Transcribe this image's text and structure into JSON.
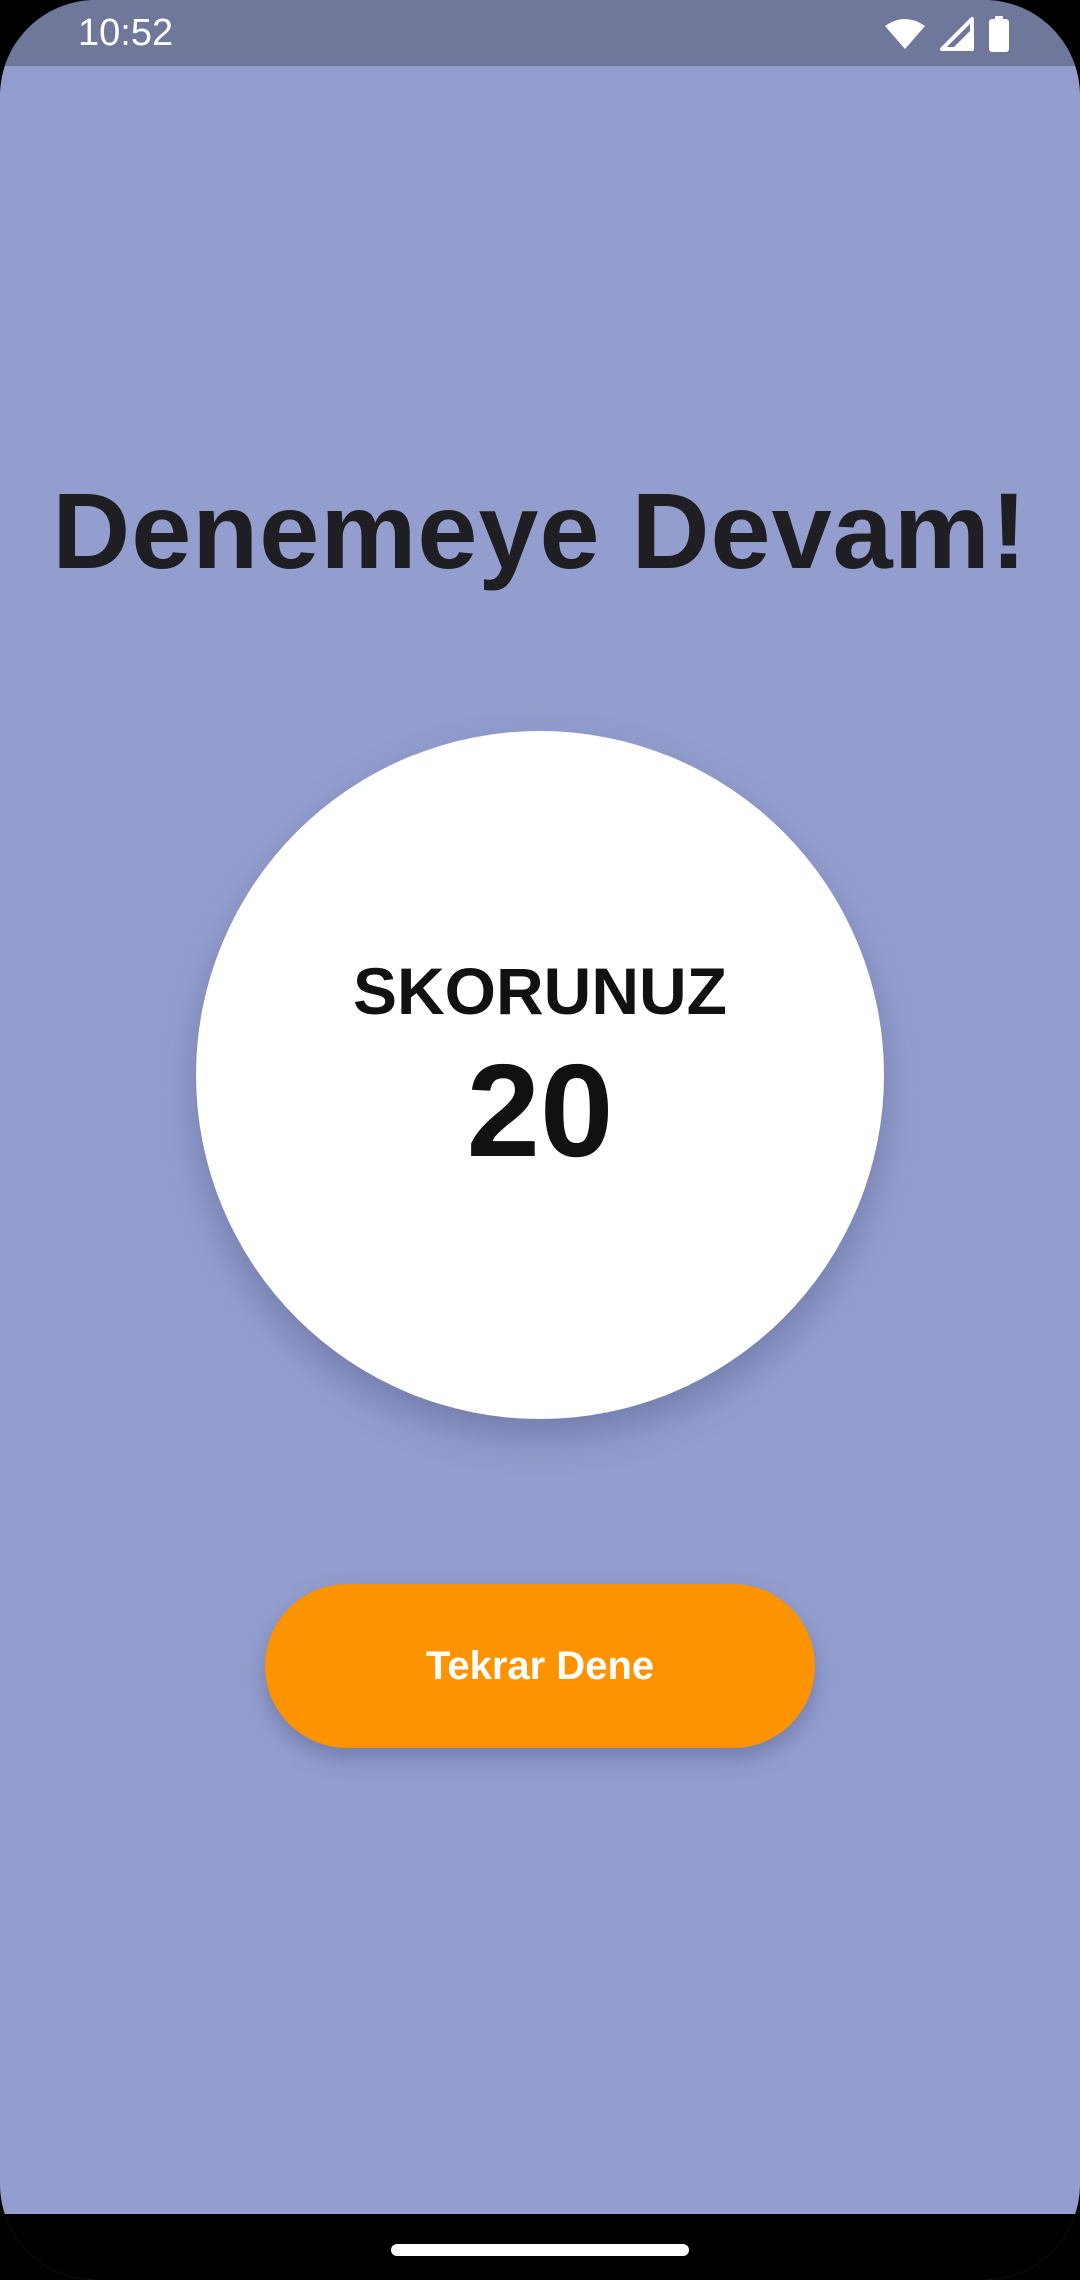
{
  "status_bar": {
    "time": "10:52",
    "icons": [
      "wifi-icon",
      "cell-signal-icon",
      "battery-icon"
    ]
  },
  "screen": {
    "title": "Denemeye Devam!",
    "score_label": "SKORUNUZ",
    "score_value": "20",
    "retry_button_label": "Tekrar Dene"
  },
  "colors": {
    "background": "#939ECF",
    "status_bar": "#6F789B",
    "circle": "#FFFFFF",
    "button": "#FE9300",
    "button_text": "#FFFFFF",
    "title_text": "#1F1F23"
  }
}
